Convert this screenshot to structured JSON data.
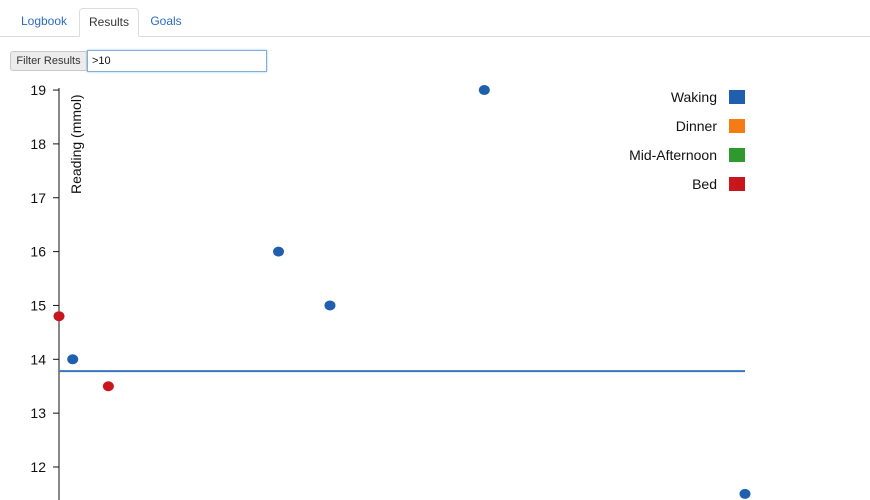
{
  "tabs": [
    {
      "label": "Logbook",
      "active": false
    },
    {
      "label": "Results",
      "active": true
    },
    {
      "label": "Goals",
      "active": false
    }
  ],
  "filter": {
    "label": "Filter Results",
    "value": ">10"
  },
  "chart_data": {
    "type": "scatter",
    "ylabel": "Reading (mmol)",
    "xlabel": "",
    "yticks": [
      12,
      13,
      14,
      15,
      16,
      17,
      18,
      19
    ],
    "ylim": [
      11.45,
      19.3
    ],
    "xlim": [
      0,
      100
    ],
    "grid": false,
    "legend_position": "top-right",
    "legend": [
      {
        "name": "Waking",
        "color": "#1f5fad"
      },
      {
        "name": "Dinner",
        "color": "#f57c12"
      },
      {
        "name": "Mid-Afternoon",
        "color": "#2e9a2e"
      },
      {
        "name": "Bed",
        "color": "#c8161c"
      }
    ],
    "series": [
      {
        "name": "Waking",
        "color": "#1f5fad",
        "points": [
          {
            "x": 2,
            "y": 14.0
          },
          {
            "x": 32,
            "y": 16.0
          },
          {
            "x": 39.5,
            "y": 15.0
          },
          {
            "x": 62,
            "y": 19.0
          },
          {
            "x": 100,
            "y": 11.5
          }
        ]
      },
      {
        "name": "Dinner",
        "color": "#f57c12",
        "points": []
      },
      {
        "name": "Mid-Afternoon",
        "color": "#2e9a2e",
        "points": []
      },
      {
        "name": "Bed",
        "color": "#c8161c",
        "points": [
          {
            "x": 0,
            "y": 14.8
          },
          {
            "x": 7.2,
            "y": 13.5
          }
        ]
      }
    ],
    "reference_line": {
      "y": 13.78,
      "color": "#3a74bb"
    }
  }
}
